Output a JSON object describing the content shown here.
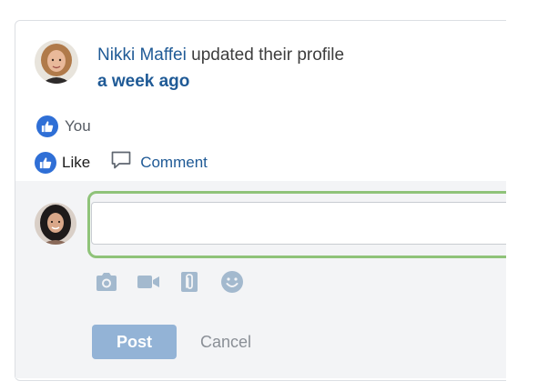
{
  "post": {
    "author_name": "Nikki Maffei",
    "action_text": "updated their profile",
    "timestamp": "a week ago"
  },
  "reactions": {
    "likers_text": "You",
    "like_label": "Like",
    "comment_label": "Comment"
  },
  "composer": {
    "value": "",
    "post_label": "Post",
    "cancel_label": "Cancel",
    "media_icons": [
      "camera-icon",
      "video-icon",
      "attachment-icon",
      "emoji-icon"
    ]
  },
  "colors": {
    "link": "#1f5a96",
    "like_badge": "#2f6fd6",
    "post_button": "#93b3d6",
    "highlight": "#8fc379",
    "composer_bg": "#f3f4f6"
  }
}
